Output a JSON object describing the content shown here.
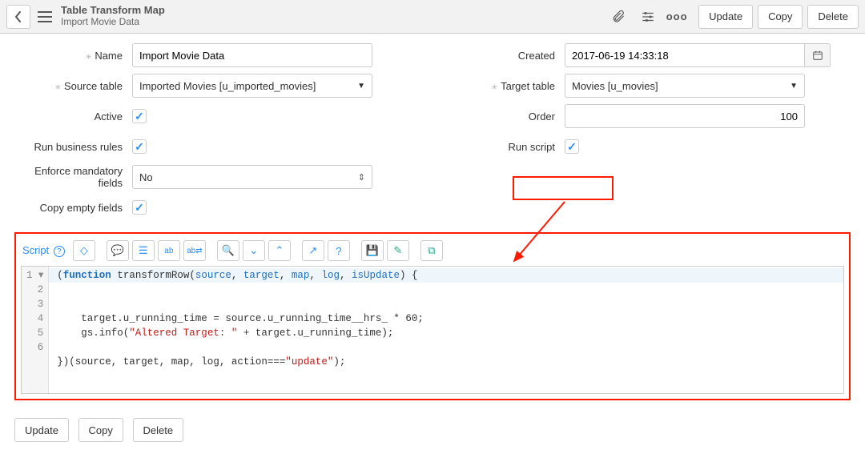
{
  "header": {
    "title": "Table Transform Map",
    "subtitle": "Import Movie Data",
    "update": "Update",
    "copy": "Copy",
    "delete": "Delete"
  },
  "left": {
    "name_label": "Name",
    "name_value": "Import Movie Data",
    "source_label": "Source table",
    "source_value": "Imported Movies [u_imported_movies]",
    "active_label": "Active",
    "biz_label": "Run business rules",
    "enforce_label": "Enforce mandatory fields",
    "enforce_value": "No",
    "copy_label": "Copy empty fields"
  },
  "right": {
    "created_label": "Created",
    "created_value": "2017-06-19 14:33:18",
    "target_label": "Target table",
    "target_value": "Movies [u_movies]",
    "order_label": "Order",
    "order_value": "100",
    "run_label": "Run script"
  },
  "script": {
    "title": "Script",
    "gutter": "1 ▾\n2\n3\n4\n5\n6",
    "code": {
      "l1a": "(",
      "l1b": "function",
      "l1c": " transformRow(",
      "l1d": "source",
      "l1e": ", ",
      "l1f": "target",
      "l1g": ", ",
      "l1h": "map",
      "l1i": ", ",
      "l1j": "log",
      "l1k": ", ",
      "l1l": "isUpdate",
      "l1m": ") {",
      "l2": "",
      "l3": "    target.u_running_time = source.u_running_time__hrs_ * 60;",
      "l4a": "    gs.info(",
      "l4b": "\"Altered Target: \"",
      "l4c": " + target.u_running_time);",
      "l5": "",
      "l6a": "})(source, target, map, log, action===",
      "l6b": "\"update\"",
      "l6c": ");"
    }
  },
  "footer": {
    "update": "Update",
    "copy": "Copy",
    "delete": "Delete"
  }
}
